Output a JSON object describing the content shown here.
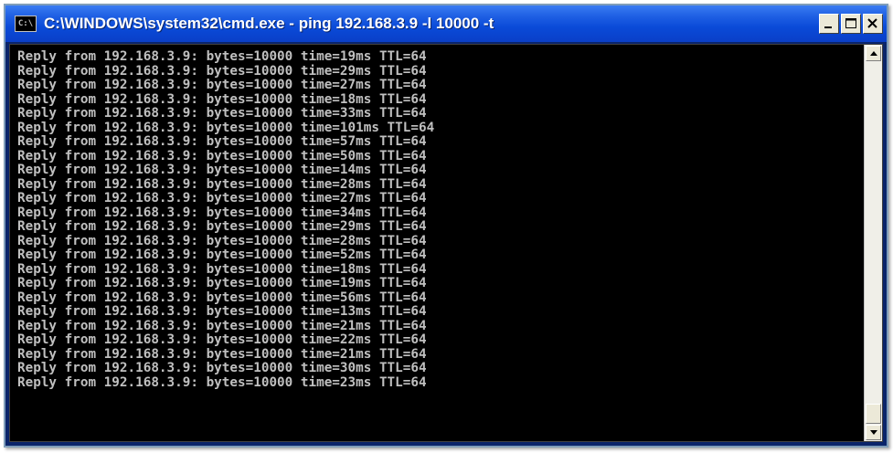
{
  "window": {
    "title": "C:\\WINDOWS\\system32\\cmd.exe - ping 192.168.3.9 -l 10000 -t",
    "icon": "cmd-icon",
    "icon_text": "C:\\"
  },
  "titlebar_buttons": {
    "minimize": "minimize-icon",
    "maximize": "maximize-icon",
    "close": "close-icon"
  },
  "console": {
    "lines": [
      "Reply from 192.168.3.9: bytes=10000 time=19ms TTL=64",
      "Reply from 192.168.3.9: bytes=10000 time=29ms TTL=64",
      "Reply from 192.168.3.9: bytes=10000 time=27ms TTL=64",
      "Reply from 192.168.3.9: bytes=10000 time=18ms TTL=64",
      "Reply from 192.168.3.9: bytes=10000 time=33ms TTL=64",
      "Reply from 192.168.3.9: bytes=10000 time=101ms TTL=64",
      "Reply from 192.168.3.9: bytes=10000 time=57ms TTL=64",
      "Reply from 192.168.3.9: bytes=10000 time=50ms TTL=64",
      "Reply from 192.168.3.9: bytes=10000 time=14ms TTL=64",
      "Reply from 192.168.3.9: bytes=10000 time=28ms TTL=64",
      "Reply from 192.168.3.9: bytes=10000 time=27ms TTL=64",
      "Reply from 192.168.3.9: bytes=10000 time=34ms TTL=64",
      "Reply from 192.168.3.9: bytes=10000 time=29ms TTL=64",
      "Reply from 192.168.3.9: bytes=10000 time=28ms TTL=64",
      "Reply from 192.168.3.9: bytes=10000 time=52ms TTL=64",
      "Reply from 192.168.3.9: bytes=10000 time=18ms TTL=64",
      "Reply from 192.168.3.9: bytes=10000 time=19ms TTL=64",
      "Reply from 192.168.3.9: bytes=10000 time=56ms TTL=64",
      "Reply from 192.168.3.9: bytes=10000 time=13ms TTL=64",
      "Reply from 192.168.3.9: bytes=10000 time=21ms TTL=64",
      "Reply from 192.168.3.9: bytes=10000 time=22ms TTL=64",
      "Reply from 192.168.3.9: bytes=10000 time=21ms TTL=64",
      "Reply from 192.168.3.9: bytes=10000 time=30ms TTL=64",
      "Reply from 192.168.3.9: bytes=10000 time=23ms TTL=64"
    ],
    "background_color": "#000000",
    "text_color": "#c0c0c0"
  },
  "scrollbar": {
    "up_icon": "scroll-up-arrow-icon",
    "down_icon": "scroll-down-arrow-icon",
    "position": 1.0
  },
  "colors": {
    "titlebar": "#0a4ad8",
    "close_button": "#ece9d8"
  }
}
